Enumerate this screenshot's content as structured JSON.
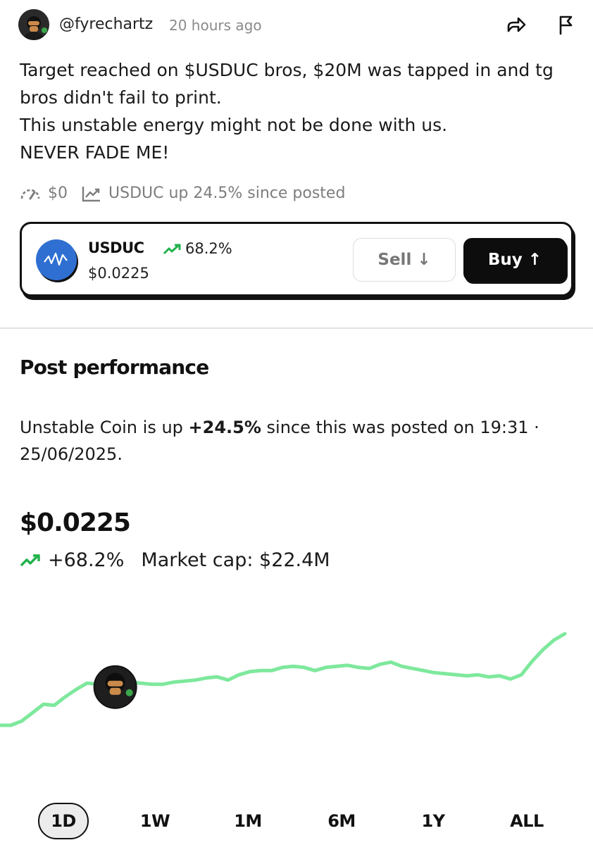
{
  "post": {
    "handle": "@fyrechartz",
    "time_ago": "20 hours ago",
    "text_lines": [
      "Target reached on $USDUC bros, $20M was tapped in and tg",
      "bros didn't fail to print.",
      "This unstable energy might not be done with us.",
      "NEVER FADE ME!"
    ]
  },
  "stats": {
    "tips": "$0",
    "performance": "USDUC up 24.5% since posted"
  },
  "token": {
    "symbol": "USDUC",
    "change": "68.2%",
    "price": "$0.0225",
    "sell_label": "Sell ↓",
    "buy_label": "Buy ↑"
  },
  "performance_section": {
    "title": "Post performance",
    "text_prefix": "Unstable Coin is up ",
    "text_bold": "+24.5%",
    "text_suffix": " since this was posted on 19:31 · 25/06/2025.",
    "price": "$0.0225",
    "change": "+68.2%",
    "market_cap": "Market cap: $22.4M"
  },
  "chart_data": {
    "type": "line",
    "series": [
      {
        "values": [
          0.0138,
          0.0138,
          0.0142,
          0.015,
          0.0158,
          0.0157,
          0.0165,
          0.0172,
          0.0178,
          0.0177,
          0.018,
          0.0181,
          0.0179,
          0.0178,
          0.0177,
          0.0177,
          0.0179,
          0.018,
          0.0181,
          0.0183,
          0.0184,
          0.0181,
          0.0186,
          0.0189,
          0.019,
          0.019,
          0.0193,
          0.0194,
          0.0193,
          0.019,
          0.0193,
          0.0194,
          0.0195,
          0.0193,
          0.0192,
          0.0196,
          0.0198,
          0.0194,
          0.0192,
          0.019,
          0.0188,
          0.0187,
          0.0186,
          0.0185,
          0.0186,
          0.0184,
          0.0185,
          0.0182,
          0.0186,
          0.0199,
          0.021,
          0.0219,
          0.0225
        ]
      }
    ],
    "posted_index": 11,
    "grid": false,
    "color": "#7ee89c"
  },
  "ranges": [
    "1D",
    "1W",
    "1M",
    "6M",
    "1Y",
    "ALL"
  ],
  "active_range": "1D",
  "colors": {
    "up": "#22b24c",
    "line": "#7ee89c",
    "token_icon": "#2f6fd1"
  }
}
